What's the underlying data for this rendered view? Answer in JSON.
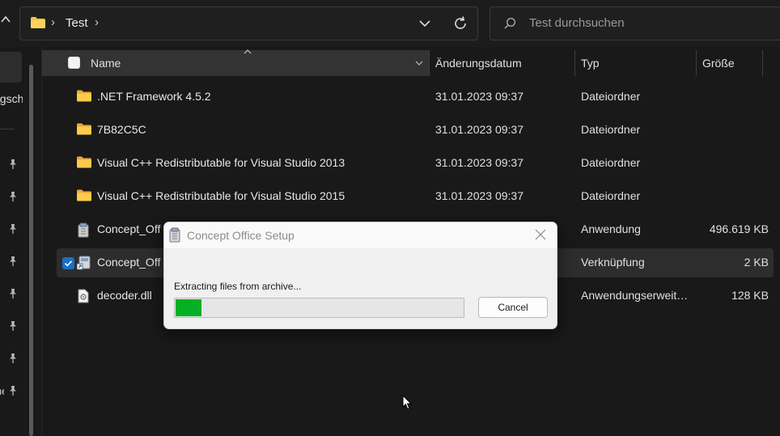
{
  "address_bar": {
    "breadcrumb": "Test",
    "separator": "›"
  },
  "search": {
    "placeholder": "Test durchsuchen"
  },
  "nav": {
    "partial_label": "egsch",
    "partial_bottom": "ne",
    "pin_count": 8
  },
  "columns": {
    "name": "Name",
    "date": "Änderungsdatum",
    "type": "Typ",
    "size": "Größe"
  },
  "rows": [
    {
      "name": ".NET Framework 4.5.2",
      "date": "31.01.2023 09:37",
      "type": "Dateiordner",
      "size": "",
      "icon": "folder-icon",
      "selected": false
    },
    {
      "name": "7B82C5C",
      "date": "31.01.2023 09:37",
      "type": "Dateiordner",
      "size": "",
      "icon": "folder-icon",
      "selected": false
    },
    {
      "name": "Visual C++ Redistributable for Visual Studio 2013",
      "date": "31.01.2023 09:37",
      "type": "Dateiordner",
      "size": "",
      "icon": "folder-icon",
      "selected": false
    },
    {
      "name": "Visual C++ Redistributable for Visual Studio 2015",
      "date": "31.01.2023 09:37",
      "type": "Dateiordner",
      "size": "",
      "icon": "folder-icon",
      "selected": false
    },
    {
      "name": "Concept_Off",
      "date": "",
      "type": "Anwendung",
      "size": "496.619 KB",
      "icon": "installer-icon",
      "selected": false
    },
    {
      "name": "Concept_Off",
      "date": "",
      "type": "Verknüpfung",
      "size": "2 KB",
      "icon": "shortcut-icon",
      "selected": true
    },
    {
      "name": "decoder.dll",
      "date": "",
      "type": "Anwendungserweiterung",
      "size": "128 KB",
      "icon": "dll-file-icon",
      "selected": false
    }
  ],
  "dialog": {
    "title": "Concept Office Setup",
    "message": "Extracting files from archive...",
    "progress": 0.09,
    "cancel_label": "Cancel"
  },
  "colors": {
    "folder": "#f5c14f",
    "progress": "#06b025",
    "checkbox_checked": "#1b6fc9"
  }
}
